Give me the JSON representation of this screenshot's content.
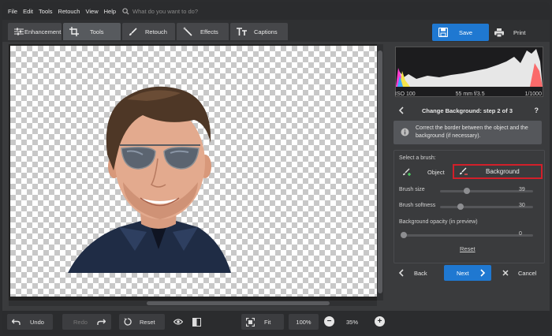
{
  "menu": [
    "File",
    "Edit",
    "Tools",
    "Retouch",
    "View",
    "Help"
  ],
  "search": {
    "placeholder": "What do you want to do?"
  },
  "tabs": [
    {
      "label": "Enhancement",
      "icon": "sliders-icon"
    },
    {
      "label": "Tools",
      "icon": "crop-icon"
    },
    {
      "label": "Retouch",
      "icon": "brush-icon"
    },
    {
      "label": "Effects",
      "icon": "magic-wand-icon"
    },
    {
      "label": "Captions",
      "icon": "text-icon"
    }
  ],
  "active_tab": "Tools",
  "header_actions": {
    "save": "Save",
    "print": "Print"
  },
  "exif": {
    "iso": "ISO 100",
    "lens": "55 mm f/3.5",
    "shutter": "1/1000"
  },
  "panel": {
    "step_title": "Change Background: step 2 of 3",
    "help": "?",
    "info": "Correct the border between the object and the background (if necessary).",
    "select_brush": "Select a brush:",
    "brush_object": "Object",
    "brush_background": "Background",
    "brush_size_label": "Brush size",
    "brush_size_value": "39",
    "brush_softness_label": "Brush softness",
    "brush_softness_value": "30",
    "bg_opacity_label": "Background opacity (in preview)",
    "bg_opacity_value": "0",
    "reset_link": "Reset"
  },
  "sliders": {
    "brush_size": 0.39,
    "brush_softness": 0.3,
    "bg_opacity": 0
  },
  "nav": {
    "back": "Back",
    "next": "Next",
    "cancel": "Cancel"
  },
  "bottom": {
    "undo": "Undo",
    "redo": "Redo",
    "reset": "Reset",
    "fit": "Fit",
    "zoom_100": "100%",
    "zoom_value": "35%"
  },
  "colors": {
    "accent": "#1f78d1",
    "highlight": "#d21f2a"
  }
}
